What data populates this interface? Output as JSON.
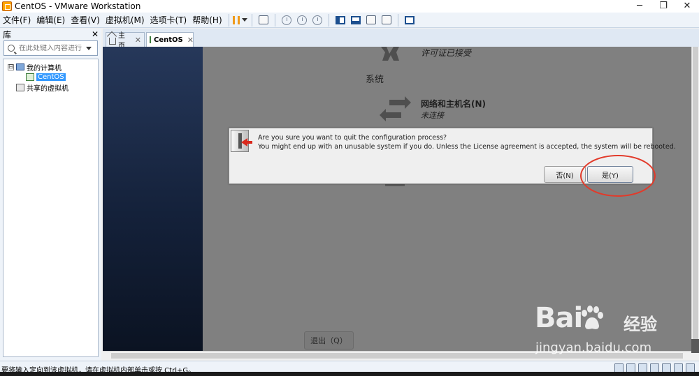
{
  "window": {
    "title": "CentOS - VMware Workstation",
    "minimize": "─",
    "restore": "❐",
    "close": "✕"
  },
  "menu": [
    {
      "label": "文件(F)"
    },
    {
      "label": "编辑(E)"
    },
    {
      "label": "查看(V)"
    },
    {
      "label": "虚拟机(M)"
    },
    {
      "label": "选项卡(T)"
    },
    {
      "label": "帮助(H)"
    }
  ],
  "library": {
    "title": "库",
    "close": "✕",
    "search_placeholder": "在此处键入内容进行...",
    "tree": {
      "my_computer": "我的计算机",
      "vm": "CentOS",
      "shared": "共享的虚拟机",
      "expander": "⊟"
    }
  },
  "tabs": [
    {
      "label": "主页",
      "close": "✕"
    },
    {
      "label": "CentOS",
      "close": "✕"
    }
  ],
  "vm": {
    "license_text": "许可证已接受",
    "system_heading": "系统",
    "network_title": "网络和主机名(N)",
    "network_status": "未连接",
    "quit_button": "退出（Q）"
  },
  "dialog": {
    "line1": "Are you sure you want to quit the configuration process?",
    "line2": "You might end up with an unusable system if you do. Unless the License agreement is accepted, the system will be rebooted.",
    "no_button": "否(N)",
    "yes_button": "是(Y)"
  },
  "watermark": {
    "logo": "Bai",
    "cn": "经验",
    "url": "jingyan.baidu.com"
  },
  "status": {
    "text": "要将输入定向到该虚拟机，请在虚拟机内部单击或按 Ctrl+G。"
  },
  "colors": {
    "annotation_ring": "#e23a2a",
    "vm_background": "#808080",
    "toolbar_bg": "#eef3f9"
  }
}
